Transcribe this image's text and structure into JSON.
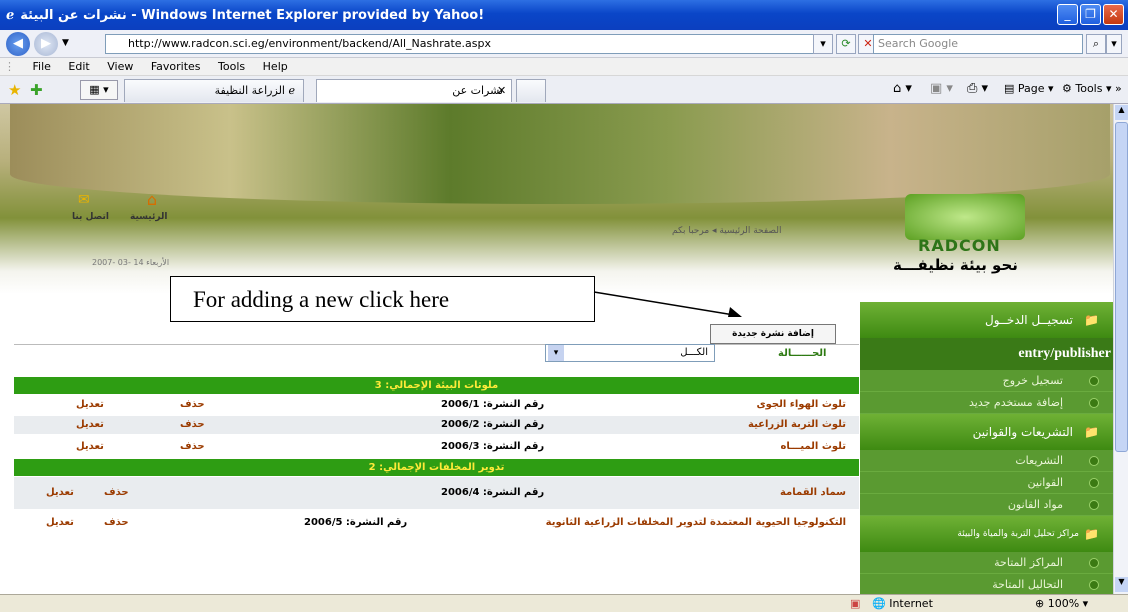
{
  "window": {
    "title": "نشرات عن البيئة - Windows Internet Explorer provided by Yahoo!"
  },
  "address": {
    "url": "http://www.radcon.sci.eg/environment/backend/All_Nashrate.aspx",
    "search_placeholder": "Search Google"
  },
  "menu": [
    "File",
    "Edit",
    "View",
    "Favorites",
    "Tools",
    "Help"
  ],
  "tabs": [
    {
      "label": "الزراعة النظيفة"
    },
    {
      "label": "نشرات عن البيئة"
    }
  ],
  "toolbar": {
    "page": "Page",
    "tools": "Tools"
  },
  "header": {
    "home": "الرئيسية",
    "contact": "اتصل بنا",
    "breadcrumb": "الصفحة الرئيسية ◂ مرحبا بكم",
    "date_day": "الأربعاء",
    "date": "2007- 03- 14",
    "logo": "RADCON",
    "slogan": "نحو بيئة نظيفـــة"
  },
  "annotation": "For adding a new click here",
  "add_button": "إضافة نشرة جديدة",
  "filter": {
    "label": "الحــــــالة",
    "value": "الكـــل"
  },
  "sections": [
    {
      "title": "ملوثات البيئة    الإجمالي: 3",
      "rows": [
        {
          "name": "تلوث الهواء الجوى",
          "num": "رقم النشرة: 2006/1",
          "del": "حذف",
          "edit": "تعديل"
        },
        {
          "name": "تلوث التربة الزراعية",
          "num": "رقم النشرة: 2006/2",
          "del": "حذف",
          "edit": "تعديل"
        },
        {
          "name": "تلوث الميـــاه",
          "num": "رقم النشرة: 2006/3",
          "del": "حذف",
          "edit": "تعديل"
        }
      ]
    },
    {
      "title": "تدوير المخلفات      الإجمالي: 2",
      "rows": [
        {
          "name": "سماد القمامة",
          "num": "رقم النشرة: 2006/4",
          "del": "حذف",
          "edit": "تعديل"
        },
        {
          "name": "التكنولوجيا الحيوية المعتمدة لتدوير المخلفات الزراعية الثانوية",
          "num": "رقم النشرة: 2006/5",
          "del": "حذف",
          "edit": "تعديل"
        }
      ]
    }
  ],
  "sidebar": {
    "login": "تسجيــل الدخــول",
    "user": "entry/publisher",
    "items1": [
      "تسجيل خروج",
      "إضافة مستخدم جديد"
    ],
    "laws": "التشريعات والقوانين",
    "items2": [
      "التشريعات",
      "القوانين",
      "مواد القانون"
    ],
    "centers": "مراكز تحليل التربة والمياة والبيئة",
    "items3": [
      "المراكز المتاحة",
      "التحاليل المتاحة"
    ]
  },
  "status": {
    "zone": "Internet",
    "zoom": "100%"
  }
}
